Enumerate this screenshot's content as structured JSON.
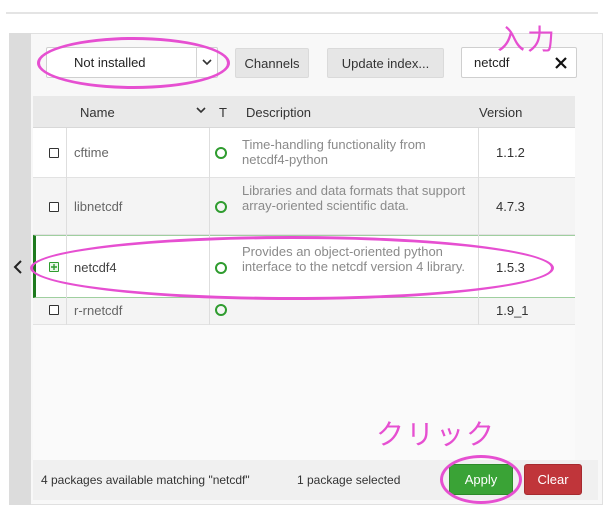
{
  "toolbar": {
    "filter_value": "Not installed",
    "channels_label": "Channels",
    "update_index_label": "Update index...",
    "search_value": "netcdf"
  },
  "table": {
    "headers": {
      "name": "Name",
      "type": "T",
      "description": "Description",
      "version": "Version"
    },
    "rows": [
      {
        "name": "cftime",
        "description": "Time-handling functionality from netcdf4-python",
        "version": "1.1.2",
        "selected": false
      },
      {
        "name": "libnetcdf",
        "description": "Libraries and data formats that support array-oriented scientific data.",
        "version": "4.7.3",
        "selected": false
      },
      {
        "name": "netcdf4",
        "description": "Provides an object-oriented python interface to the netcdf version 4 library.",
        "version": "1.5.3",
        "selected": true
      },
      {
        "name": "r-rnetcdf",
        "description": "",
        "version": "1.9_1",
        "selected": false
      }
    ]
  },
  "status": {
    "count_text": "4 packages available matching \"netcdf\"",
    "selected_text": "1 package selected"
  },
  "actions": {
    "apply_label": "Apply",
    "clear_label": "Clear"
  },
  "annotations": {
    "input_note": "入力",
    "click_note": "クリック"
  },
  "colors": {
    "accent_green": "#3aa336",
    "danger_red": "#c0353a",
    "annotation_magenta": "#e64fd1"
  }
}
